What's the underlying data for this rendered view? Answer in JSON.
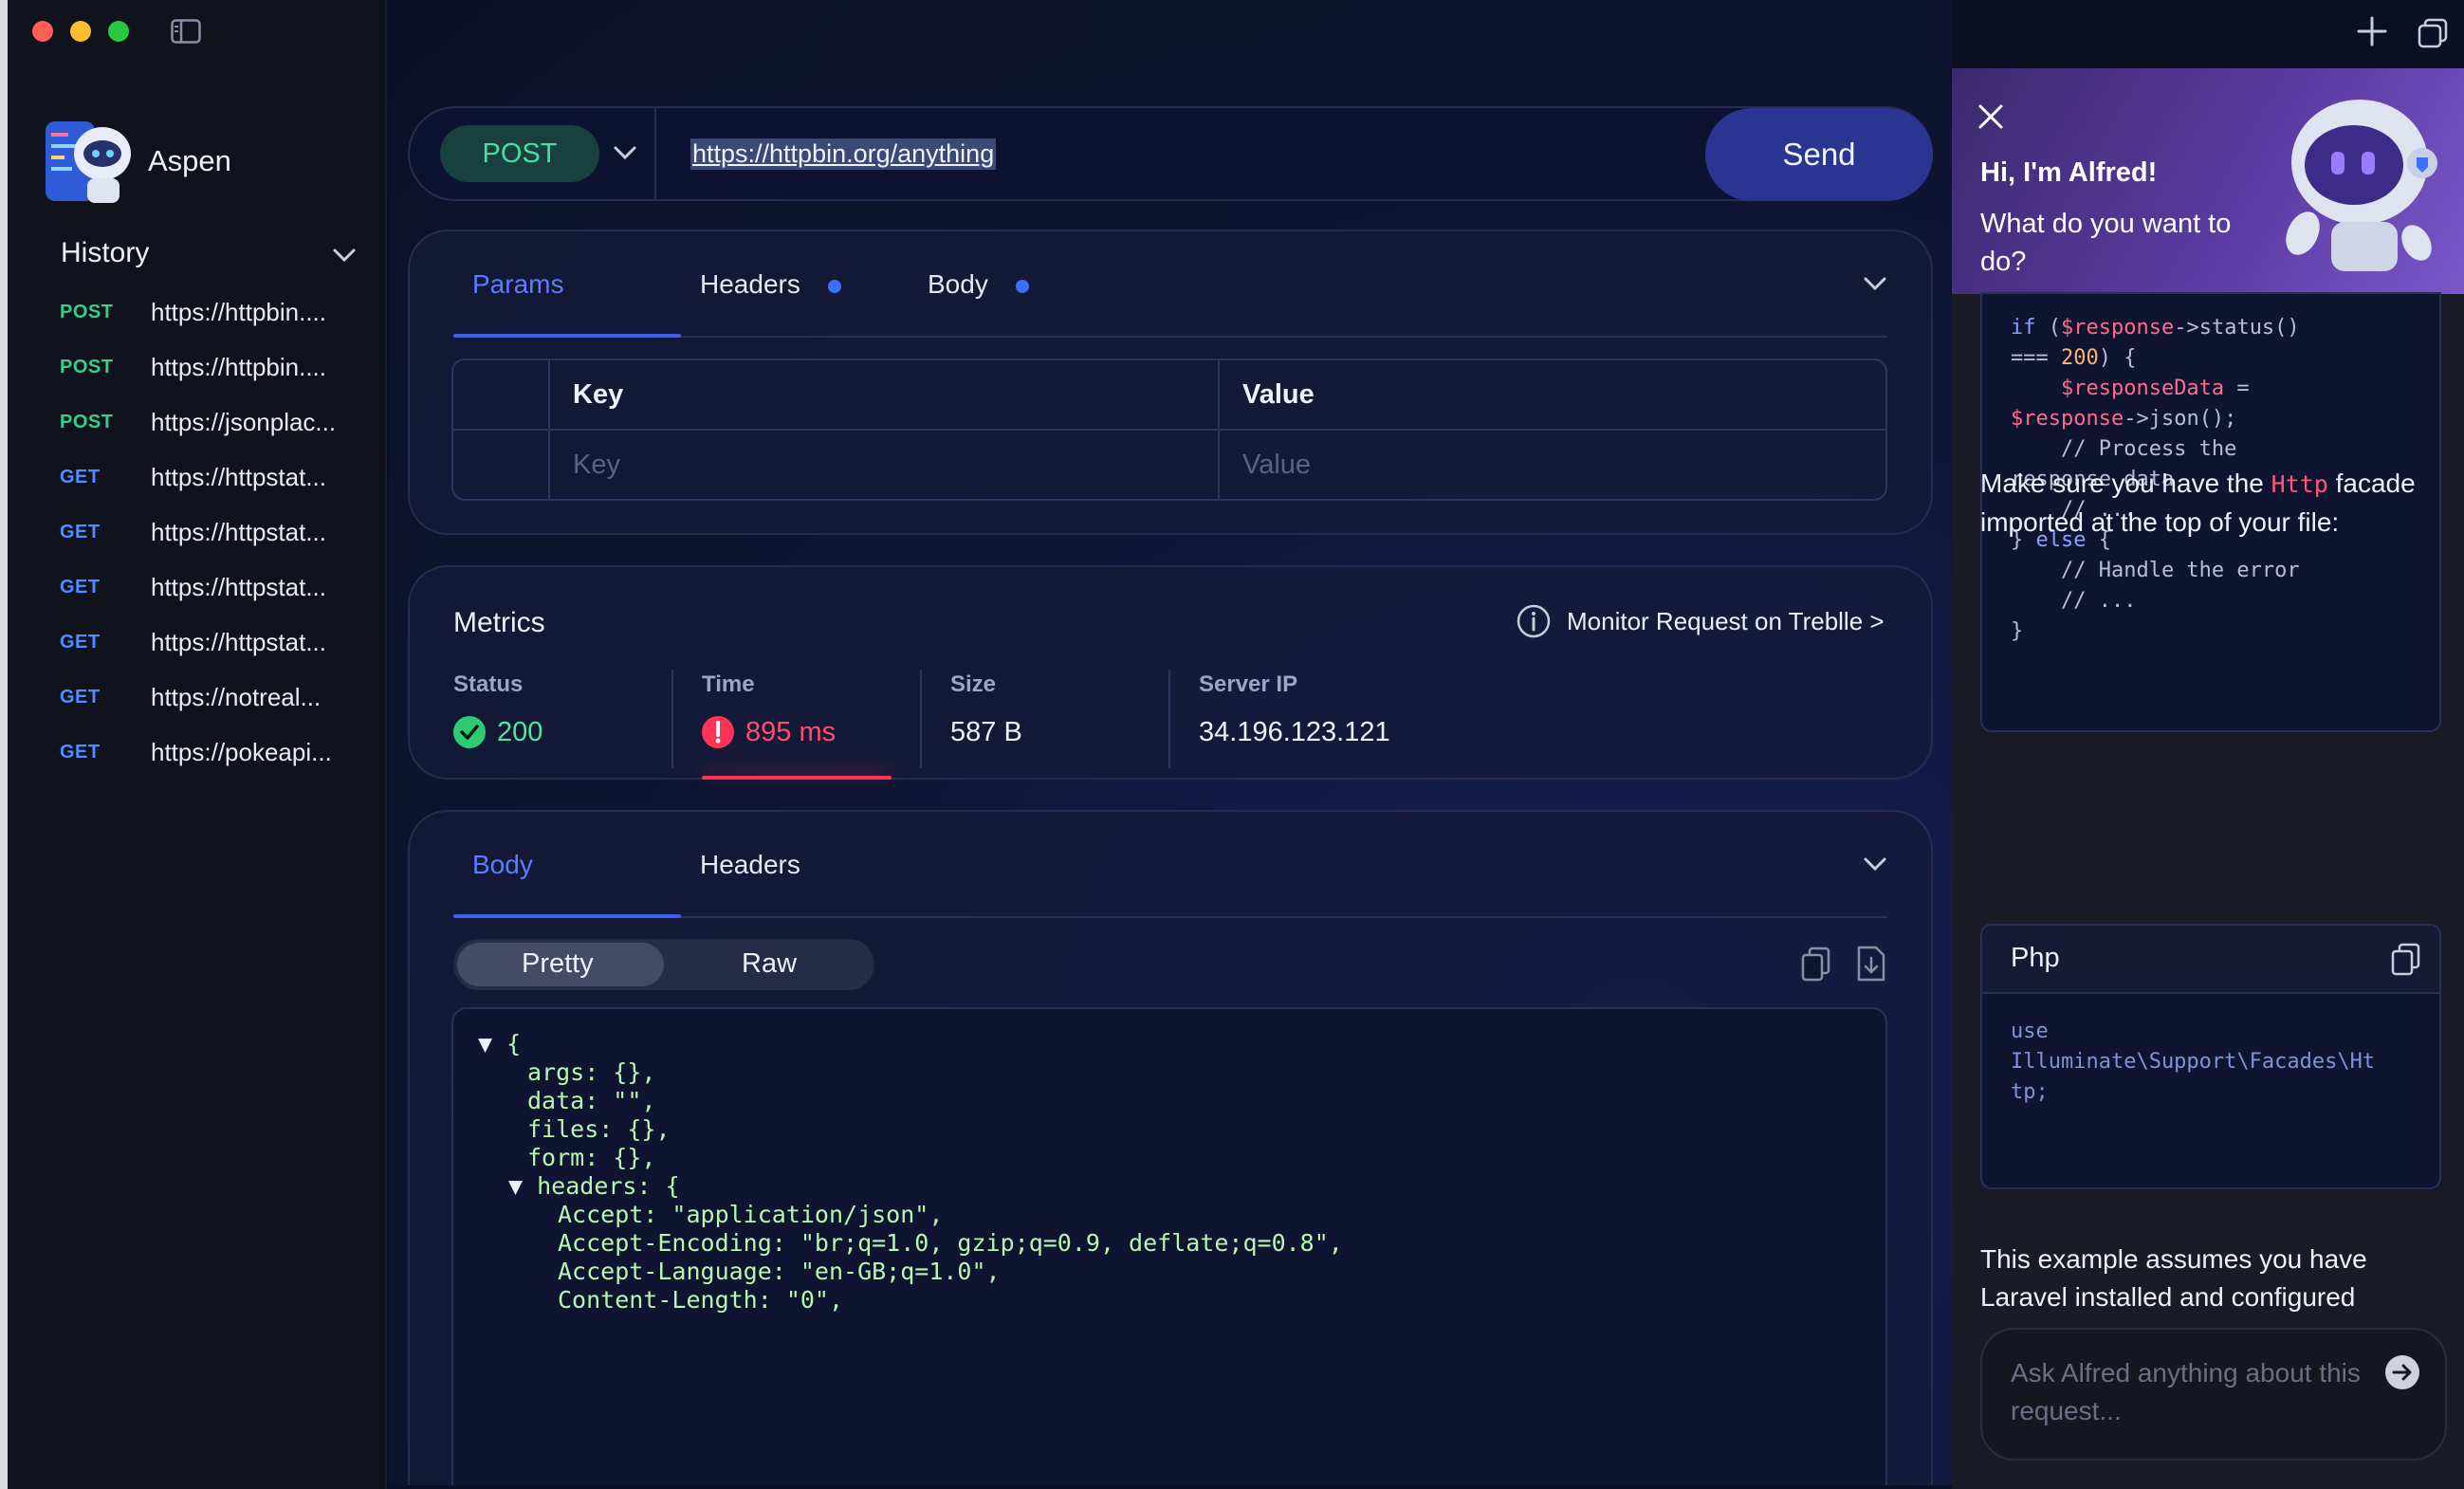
{
  "app": {
    "name": "Aspen"
  },
  "sidebar": {
    "history_label": "History",
    "items": [
      {
        "method": "POST",
        "url": "https://httpbin...."
      },
      {
        "method": "POST",
        "url": "https://httpbin...."
      },
      {
        "method": "POST",
        "url": "https://jsonplac..."
      },
      {
        "method": "GET",
        "url": "https://httpstat..."
      },
      {
        "method": "GET",
        "url": "https://httpstat..."
      },
      {
        "method": "GET",
        "url": "https://httpstat..."
      },
      {
        "method": "GET",
        "url": "https://httpstat..."
      },
      {
        "method": "GET",
        "url": "https://notreal..."
      },
      {
        "method": "GET",
        "url": "https://pokeapi..."
      }
    ]
  },
  "request": {
    "method": "POST",
    "url": "https://httpbin.org/anything",
    "send_label": "Send"
  },
  "request_tabs": [
    {
      "label": "Params",
      "active": true,
      "dot": false
    },
    {
      "label": "Headers",
      "active": false,
      "dot": true
    },
    {
      "label": "Body",
      "active": false,
      "dot": true
    }
  ],
  "params_table": {
    "key_header": "Key",
    "value_header": "Value",
    "key_placeholder": "Key",
    "value_placeholder": "Value"
  },
  "metrics": {
    "title": "Metrics",
    "monitor_link": "Monitor Request on Treblle >",
    "status": {
      "label": "Status",
      "value": "200"
    },
    "time": {
      "label": "Time",
      "value": "895 ms"
    },
    "size": {
      "label": "Size",
      "value": "587 B"
    },
    "server_ip": {
      "label": "Server IP",
      "value": "34.196.123.121"
    }
  },
  "response_tabs": [
    {
      "label": "Body",
      "active": true
    },
    {
      "label": "Headers",
      "active": false
    }
  ],
  "view_toggle": {
    "pretty": "Pretty",
    "raw": "Raw",
    "selected": "Pretty"
  },
  "response_json_lines": [
    "{",
    "args: {},",
    "data: \"\",",
    "files: {},",
    "form: {},",
    "headers: {",
    "Accept: \"application/json\",",
    "Accept-Encoding: \"br;q=1.0, gzip;q=0.9, deflate;q=0.8\",",
    "Accept-Language: \"en-GB;q=1.0\",",
    "Content-Length: \"0\","
  ],
  "alfred": {
    "greeting": "Hi, I'm Alfred!",
    "question": "What do you want to do?",
    "snippet_lines": [
      "if ($response->status()",
      "=== 200) {",
      "    $responseData =",
      "$response->json();",
      "    // Process the",
      "response data",
      "    // ...",
      "} else {",
      "    // Handle the error",
      "    // ...",
      "}"
    ],
    "note_before": "Make sure you have the",
    "note_code": "Http",
    "note_after": "facade imported at the top of your file:",
    "php_title": "Php",
    "php_code_lines": [
      "use",
      "Illuminate\\Support\\Facades\\Ht",
      "tp;"
    ],
    "assumption": "This example assumes you have Laravel installed and configured",
    "ask_placeholder": "Ask Alfred anything about this request..."
  },
  "colors": {
    "accent": "#3f5ff0",
    "post": "#33d08a",
    "get": "#4d8dff",
    "success": "#2ecc71",
    "error": "#ff3355"
  }
}
